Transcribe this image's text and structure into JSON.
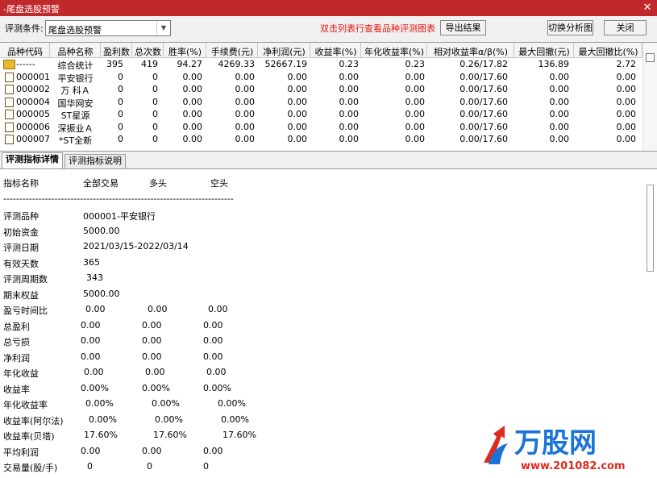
{
  "window": {
    "title": "-尾盘选股预警",
    "close_glyph": "✕"
  },
  "toolbar": {
    "condition_label": "评测条件:",
    "condition_value": "尾盘选股预警",
    "hint": "双击列表行查看品种评测图表",
    "export_label": "导出结果",
    "switch_label": "切换分析图",
    "close_label": "关闭"
  },
  "grid": {
    "columns": [
      "品种代码",
      "品种名称",
      "盈利数",
      "总次数",
      "胜率(%)",
      "手续费(元)",
      "净利润(元)",
      "收益率(%)",
      "年化收益率(%)",
      "相对收益率α/β(%)",
      "最大回撤(元)",
      "最大回撤比(%)"
    ],
    "rows": [
      [
        "------",
        "综合统计",
        "395",
        "419",
        "94.27",
        "4269.33",
        "52667.19",
        "0.23",
        "0.23",
        "0.26/17.82",
        "136.89",
        "2.72"
      ],
      [
        "000001",
        "平安银行",
        "0",
        "0",
        "0.00",
        "0.00",
        "0.00",
        "0.00",
        "0.00",
        "0.00/17.60",
        "0.00",
        "0.00"
      ],
      [
        "000002",
        "万 科Ａ",
        "0",
        "0",
        "0.00",
        "0.00",
        "0.00",
        "0.00",
        "0.00",
        "0.00/17.60",
        "0.00",
        "0.00"
      ],
      [
        "000004",
        "国华网安",
        "0",
        "0",
        "0.00",
        "0.00",
        "0.00",
        "0.00",
        "0.00",
        "0.00/17.60",
        "0.00",
        "0.00"
      ],
      [
        "000005",
        "ST星源",
        "0",
        "0",
        "0.00",
        "0.00",
        "0.00",
        "0.00",
        "0.00",
        "0.00/17.60",
        "0.00",
        "0.00"
      ],
      [
        "000006",
        "深振业Ａ",
        "0",
        "0",
        "0.00",
        "0.00",
        "0.00",
        "0.00",
        "0.00",
        "0.00/17.60",
        "0.00",
        "0.00"
      ],
      [
        "000007",
        "*ST全新",
        "0",
        "0",
        "0.00",
        "0.00",
        "0.00",
        "0.00",
        "0.00",
        "0.00/17.60",
        "0.00",
        "0.00"
      ]
    ]
  },
  "tabs": [
    "评测指标详情",
    "评测指标说明"
  ],
  "detail": {
    "header": [
      "指标名称",
      "全部交易",
      "多头",
      "空头"
    ],
    "divider": "------------------------------------------------------------------------",
    "info": [
      [
        "评测品种",
        "000001-平安银行"
      ],
      [
        "初始资金",
        "5000.00"
      ],
      [
        "评测日期",
        "2021/03/15-2022/03/14"
      ],
      [
        "有效天数",
        "365"
      ],
      [
        "评测周期数",
        "343"
      ],
      [
        "期末权益",
        "5000.00"
      ]
    ],
    "metrics": [
      [
        "盈亏时间比",
        "0.00",
        "0.00",
        "0.00"
      ],
      [
        "总盈利",
        "0.00",
        "0.00",
        "0.00"
      ],
      [
        "总亏损",
        "0.00",
        "0.00",
        "0.00"
      ],
      [
        "净利润",
        "0.00",
        "0.00",
        "0.00"
      ],
      [
        "年化收益",
        "0.00",
        "0.00",
        "0.00"
      ],
      [
        "收益率",
        "0.00%",
        "0.00%",
        "0.00%"
      ],
      [
        "年化收益率",
        "0.00%",
        "0.00%",
        "0.00%"
      ],
      [
        "收益率(阿尔法)",
        "0.00%",
        "0.00%",
        "0.00%"
      ],
      [
        "收益率(贝塔)",
        "17.60%",
        "17.60%",
        "17.60%"
      ],
      [
        "平均利润",
        "0.00",
        "0.00",
        "0.00"
      ],
      [
        "交易量(股/手)",
        "0",
        "0",
        "0"
      ]
    ]
  },
  "watermark": {
    "name": "万股网",
    "url": "www.201082.com"
  },
  "colors": {
    "titlebar": "#c0282c",
    "hint": "#e8150b",
    "logo_blue": "#1a73d6",
    "logo_red": "#e02a20"
  }
}
